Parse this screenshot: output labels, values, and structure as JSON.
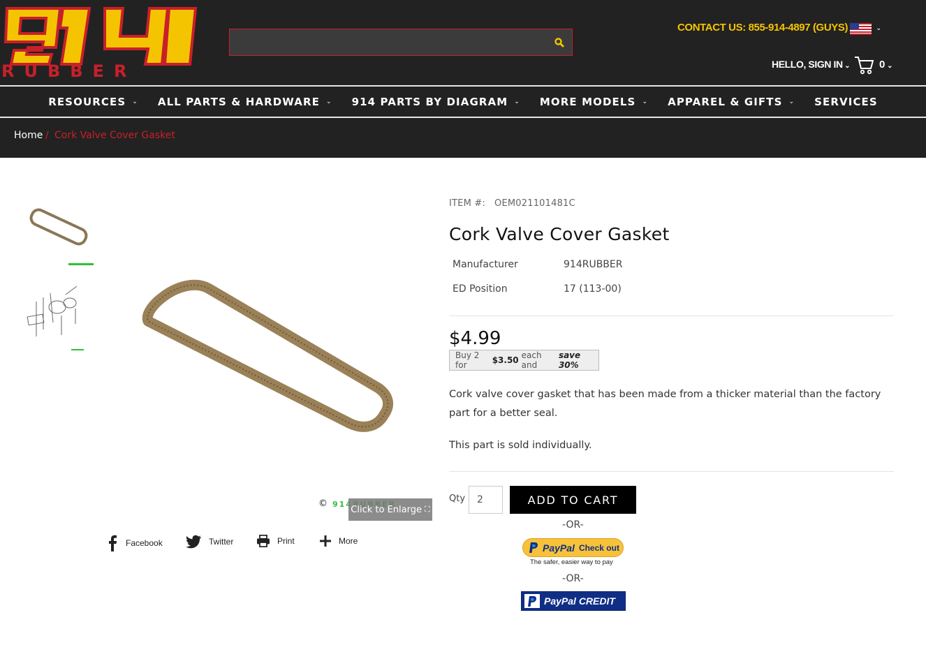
{
  "header": {
    "logo_top": "914",
    "logo_bottom": "RUBBER",
    "search_placeholder": "",
    "contact": "CONTACT US: 855-914-4897 (GUYS)",
    "signin": "HELLO, SIGN IN",
    "cart_count": "0"
  },
  "nav": {
    "items": [
      {
        "label": "RESOURCES"
      },
      {
        "label": "ALL PARTS & HARDWARE"
      },
      {
        "label": "914 PARTS BY DIAGRAM"
      },
      {
        "label": "MORE MODELS"
      },
      {
        "label": "APPAREL & GIFTS"
      },
      {
        "label": "SERVICES"
      }
    ]
  },
  "breadcrumb": {
    "home": "Home",
    "sep": "/",
    "current": "Cork Valve Cover Gasket"
  },
  "gallery": {
    "enlarge_label": "Click to Enlarge",
    "watermark": "914RUBBER",
    "copyright": "©"
  },
  "share": {
    "facebook": "Facebook",
    "twitter": "Twitter",
    "print": "Print",
    "more": "More"
  },
  "product": {
    "item_label": "ITEM #:",
    "item_number": "OEM021101481C",
    "title": "Cork Valve Cover Gasket",
    "specs": [
      {
        "label": "Manufacturer",
        "value": "914RUBBER"
      },
      {
        "label": "ED Position",
        "value": "17 (113-00)"
      }
    ],
    "price": "$4.99",
    "bulk_pre": "Buy 2 for",
    "bulk_price": "$3.50",
    "bulk_mid": "each and",
    "bulk_save": "save 30%",
    "description": "Cork valve cover gasket that has been made from a thicker material than the factory part for a better seal.",
    "description2": "This part is sold individually.",
    "qty_label": "Qty",
    "qty_value": "2",
    "add_to_cart": "ADD TO CART",
    "or_label": "-OR-",
    "paypal_brand": "PayPal",
    "paypal_checkout": "Check out",
    "paypal_tagline": "The safer, easier way to pay",
    "paypal_credit": "PayPal CREDIT"
  },
  "colors": {
    "header_bg": "#222222",
    "accent_red": "#c8202a",
    "accent_yellow": "#f5c400"
  }
}
